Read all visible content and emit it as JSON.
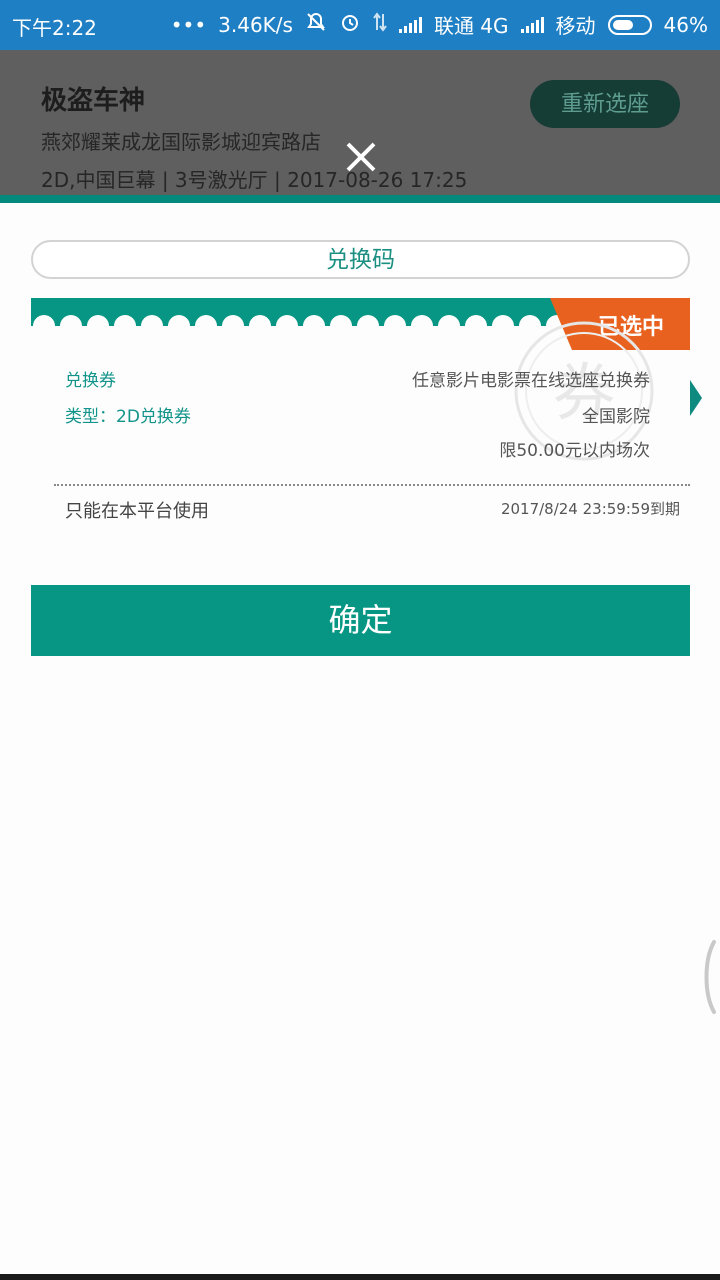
{
  "status_bar": {
    "time": "下午2:22",
    "dots": "•••",
    "speed": "3.46K/s",
    "carrier1": "联通 4G",
    "carrier2": "移动",
    "battery": "46%"
  },
  "header": {
    "movie_title": "极盗车神",
    "cinema": "燕郊耀莱成龙国际影城迎宾路店",
    "session": "2D,中国巨幕 | 3号激光厅 | 2017-08-26 17:25",
    "reselect_label": "重新选座"
  },
  "exchange_code_button": "兑换码",
  "coupon": {
    "selected_label": "已选中",
    "name": "兑换券",
    "type": "类型：2D兑换券",
    "desc": "任意影片电影票在线选座兑换券",
    "scope": "全国影院",
    "limit": "限50.00元以内场次",
    "usage": "只能在本平台使用",
    "expiry": "2017/8/24 23:59:59到期",
    "watermark": "券",
    "colors": {
      "accent": "#069683",
      "selected": "#e8611e"
    }
  },
  "confirm_label": "确定"
}
